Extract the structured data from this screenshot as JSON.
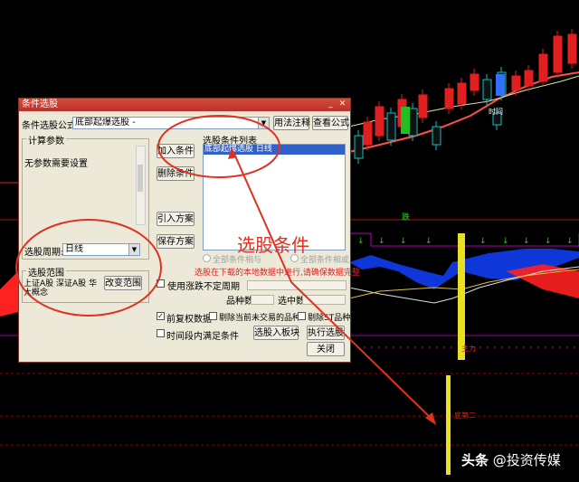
{
  "dialog": {
    "title": "条件选股",
    "formula_label": "条件选股公式",
    "formula_value": "底部起爆选股 -",
    "usage_button": "用法注释",
    "view_formula_button": "查看公式",
    "params_group": "计算参数",
    "no_params_text": "无参数需要设置",
    "period_label": "选股周期:",
    "period_value": "日线",
    "range_group": "选股范围",
    "range_text_line1": "上证A股 深证A股 华",
    "range_text_line2": "大概念",
    "change_range_button": "改变范围",
    "add_condition_button": "加入条件",
    "delete_condition_button": "删除条件",
    "import_plan_button": "引入方案",
    "save_plan_button": "保存方案",
    "condition_list_label": "选股条件列表",
    "condition_items": [
      "底部起爆选股   日线"
    ],
    "all_and_label": "全部条件相与",
    "all_or_label": "全部条件相或",
    "warning_text": "选股在下载的本地数据中进行,请确保数据完整",
    "use_fluctuation_label": "使用涨跌不定周期",
    "stock_count_label": "品种数",
    "selected_count_label": "选中数",
    "pre_adjust_label": "前复权数据",
    "pre_adjust_checked": true,
    "exclude_untraded_label": "剔除当前未交易的品种",
    "exclude_st_label": "剔除ST品种",
    "time_period_label": "时间段内满足条件",
    "select_to_block_button": "选股入板块",
    "execute_button": "执行选股",
    "close_button": "关闭",
    "minimize_icon": "minimize-icon",
    "close_icon": "close-icon"
  },
  "annotation": {
    "big_label": "选股条件",
    "color": "#e03020"
  },
  "chart": {
    "marker_jump": "跌",
    "marker_jump2": "时间",
    "marker_main": "主力",
    "marker_bottom": "底第二",
    "up_color": "#e02020",
    "down_color": "#10c0c0"
  },
  "watermark": {
    "brand": "头条",
    "account": "@投资传媒"
  }
}
